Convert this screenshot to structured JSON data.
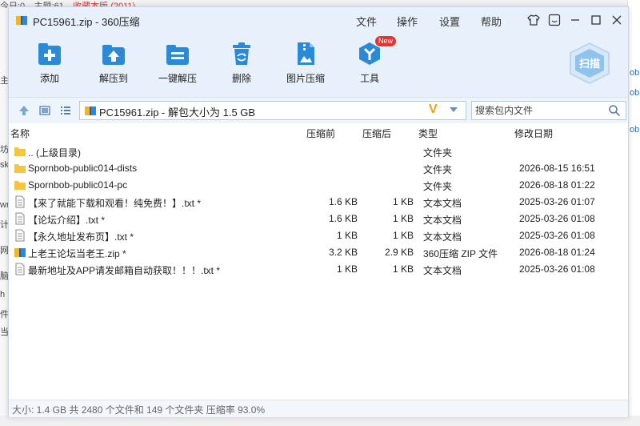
{
  "background": {
    "top_text_1": "今日:0",
    "top_text_2": "主题:61",
    "top_text_3": "收藏本版 (2011)",
    "left_chars": [
      "主",
      "坊",
      "sk",
      "wr",
      "计",
      "网",
      "脑",
      "h",
      "件",
      "当"
    ],
    "right_chars": [
      "ob",
      "ob",
      "ob"
    ]
  },
  "window": {
    "title": "PC15961.zip - 360压缩",
    "menu": [
      "文件",
      "操作",
      "设置",
      "帮助"
    ],
    "controls": [
      "shirt-icon",
      "smile-icon",
      "minimize",
      "maximize",
      "close"
    ]
  },
  "toolbar": {
    "items": [
      {
        "label": "添加",
        "icon": "add-icon"
      },
      {
        "label": "解压到",
        "icon": "extract-to-icon"
      },
      {
        "label": "一键解压",
        "icon": "one-click-extract-icon"
      },
      {
        "label": "删除",
        "icon": "delete-icon"
      },
      {
        "label": "图片压缩",
        "icon": "image-compress-icon"
      },
      {
        "label": "工具",
        "icon": "tools-icon"
      }
    ],
    "new_badge": "New",
    "scan_label": "扫描"
  },
  "nav": {
    "path": "PC15961.zip - 解包大小为 1.5 GB",
    "v_mark": "V",
    "search_placeholder": "搜索包内文件"
  },
  "columns": {
    "name": "名称",
    "compressed_before": "压缩前",
    "compressed_after": "压缩后",
    "type": "类型",
    "modified": "修改日期"
  },
  "files": [
    {
      "name": ".. (上级目录)",
      "before": "",
      "after": "",
      "type": "文件夹",
      "date": "",
      "icon": "folder"
    },
    {
      "name": "Spornbob-public014-dists",
      "before": "",
      "after": "",
      "type": "文件夹",
      "date": "2026-08-15 16:51",
      "icon": "folder"
    },
    {
      "name": "Spornbob-public014-pc",
      "before": "",
      "after": "",
      "type": "文件夹",
      "date": "2026-08-18 01:22",
      "icon": "folder"
    },
    {
      "name": "【来了就能下载和观看！纯免费！】.txt *",
      "before": "1.6 KB",
      "after": "1 KB",
      "type": "文本文档",
      "date": "2025-03-26 01:07",
      "icon": "text"
    },
    {
      "name": "【论坛介绍】.txt *",
      "before": "1.6 KB",
      "after": "1 KB",
      "type": "文本文档",
      "date": "2025-03-26 01:08",
      "icon": "text"
    },
    {
      "name": "【永久地址发布页】.txt *",
      "before": "1 KB",
      "after": "1 KB",
      "type": "文本文档",
      "date": "2025-03-26 01:08",
      "icon": "text"
    },
    {
      "name": "上老王论坛当老王.zip *",
      "before": "3.2 KB",
      "after": "2.9 KB",
      "type": "360压缩 ZIP 文件",
      "date": "2026-08-18 01:24",
      "icon": "zip"
    },
    {
      "name": "最新地址及APP请发邮箱自动获取！！！.txt *",
      "before": "1 KB",
      "after": "1 KB",
      "type": "文本文档",
      "date": "2025-03-26 01:08",
      "icon": "text"
    }
  ],
  "status": "大小: 1.4 GB 共 2480 个文件和 149 个文件夹 压缩率 93.0%",
  "colors": {
    "accent": "#2a8ad8",
    "title_bg": "#e8f1fb",
    "new_badge": "#e8322e",
    "v_mark": "#e8a317"
  }
}
